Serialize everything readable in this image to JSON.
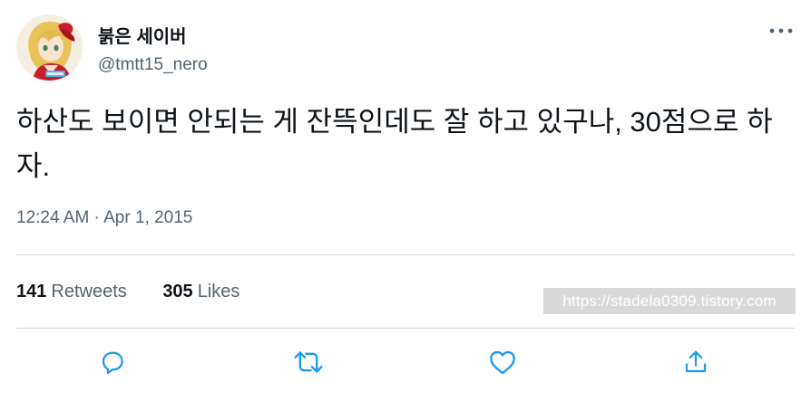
{
  "author": {
    "display_name": "붉은 세이버",
    "handle": "@tmtt15_nero",
    "avatar_icon": "avatar-image"
  },
  "tweet": {
    "text": "하산도 보이면 안되는 게 잔뜩인데도 잘 하고 있구나, 30점으로 하자.",
    "timestamp": "12:24 AM · Apr 1, 2015"
  },
  "stats": {
    "retweets_count": "141",
    "retweets_label": "Retweets",
    "likes_count": "305",
    "likes_label": "Likes"
  },
  "watermark": "https://stadela0309.tistory.com",
  "actions": [
    "reply-icon",
    "retweet-icon",
    "like-icon",
    "share-icon"
  ],
  "colors": {
    "text": "#0f1419",
    "secondary": "#536471",
    "icon": "#1d9bf0",
    "divider": "#cfd9de"
  }
}
